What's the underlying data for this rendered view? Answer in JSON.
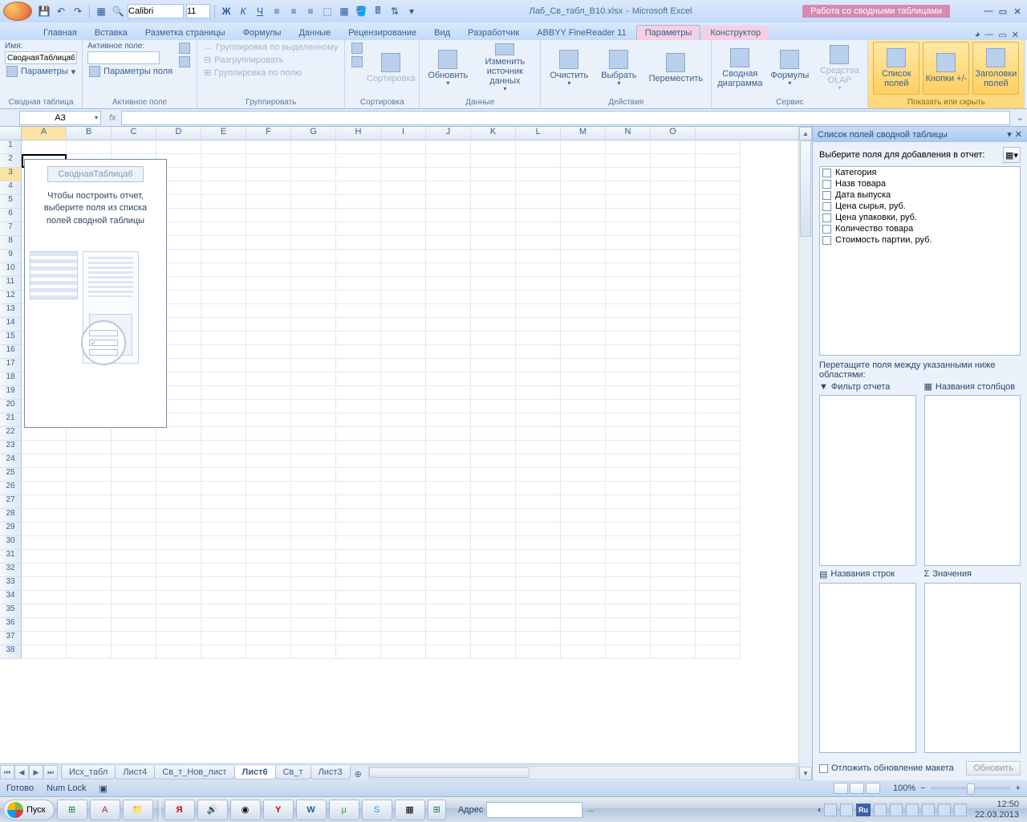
{
  "title": {
    "doc": "Лаб_Св_табл_В10.xlsx",
    "app": "Microsoft Excel",
    "contextual": "Работа со сводными таблицами"
  },
  "qat": {
    "font": "Calibri",
    "size": "11"
  },
  "tabs": {
    "items": [
      "Главная",
      "Вставка",
      "Разметка страницы",
      "Формулы",
      "Данные",
      "Рецензирование",
      "Вид",
      "Разработчик",
      "ABBYY FineReader 11",
      "Параметры",
      "Конструктор"
    ],
    "active": "Параметры"
  },
  "ribbon": {
    "g0": {
      "name_lbl": "Имя:",
      "name_val": "СводнаяТаблица6",
      "params": "Параметры",
      "label": "Сводная таблица"
    },
    "g1": {
      "title": "Активное поле:",
      "fieldparams": "Параметры поля",
      "label": "Активное поле"
    },
    "g2": {
      "i1": "Группировка по выделенному",
      "i2": "Разгруппировать",
      "i3": "Группировка по полю",
      "label": "Группировать"
    },
    "g3": {
      "sort": "Сортировка",
      "label": "Сортировка"
    },
    "g4": {
      "refresh": "Обновить",
      "source": "Изменить источник данных",
      "label": "Данные"
    },
    "g5": {
      "clear": "Очистить",
      "select": "Выбрать",
      "move": "Переместить",
      "label": "Действия"
    },
    "g6": {
      "chart": "Сводная диаграмма",
      "formulas": "Формулы",
      "olap": "Средства OLAP",
      "label": "Сервис"
    },
    "g7": {
      "b1": "Список полей",
      "b2": "Кнопки +/-",
      "b3": "Заголовки полей",
      "label": "Показать или скрыть"
    }
  },
  "namebox": "A3",
  "cols": [
    "A",
    "B",
    "C",
    "D",
    "E",
    "F",
    "G",
    "H",
    "I",
    "J",
    "K",
    "L",
    "M",
    "N",
    "O"
  ],
  "pivot": {
    "title": "СводнаяТаблица6",
    "text1": "Чтобы построить отчет,",
    "text2": "выберите поля из списка",
    "text3": "полей сводной таблицы"
  },
  "sheets": [
    "Исх_табл",
    "Лист4",
    "Св_т_Нов_лист",
    "Лист6",
    "Св_т",
    "Лист3"
  ],
  "sheets_active": "Лист6",
  "fieldpane": {
    "title": "Список полей сводной таблицы",
    "prompt": "Выберите поля для добавления в отчет:",
    "fields": [
      "Категория",
      "Назв товара",
      "Дата выпуска",
      "Цена сырья, руб.",
      "Цена упаковки, руб.",
      "Количество товара",
      "Стоимость партии, руб."
    ],
    "drag": "Перетащите поля между указанными ниже областями:",
    "areas": {
      "filter": "Фильтр отчета",
      "cols": "Названия столбцов",
      "rows": "Названия строк",
      "vals": "Значения"
    },
    "defer": "Отложить обновление макета",
    "update": "Обновить"
  },
  "status": {
    "ready": "Готово",
    "numlock": "Num Lock",
    "zoom": "100%"
  },
  "taskbar": {
    "start": "Пуск",
    "addr": "Адрес",
    "lang": "Ru",
    "time": "12:50",
    "date": "22.03.2013"
  }
}
